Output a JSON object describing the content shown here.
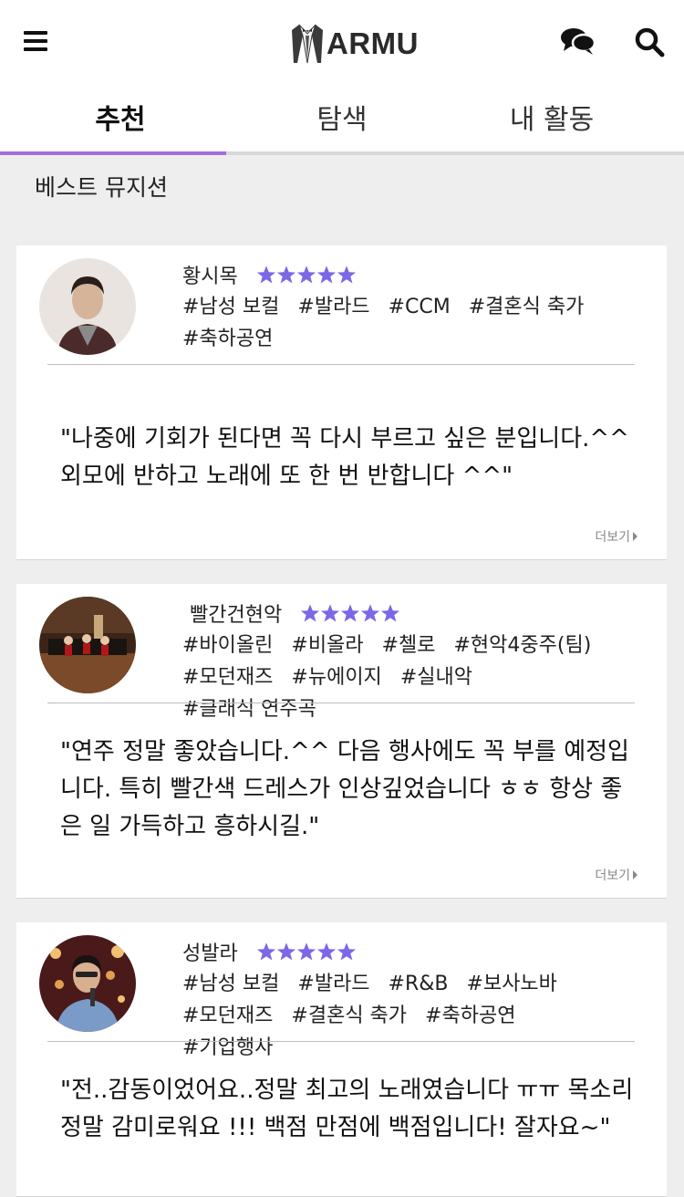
{
  "header": {
    "logo_text": "ARMU",
    "tabs": [
      {
        "label": "추천",
        "active": true
      },
      {
        "label": "탐색",
        "active": false
      },
      {
        "label": "내 활동",
        "active": false
      }
    ],
    "accent_color": "#a56ae0"
  },
  "section_title": "베스트 뮤지션",
  "star_color": "#7b68e6",
  "cards": [
    {
      "name": "황시목",
      "rating": 5,
      "tags_line1": [
        "#남성 보컬",
        "#발라드",
        "#CCM",
        "#결혼식 축가"
      ],
      "tags_line2": [
        "#축하공연"
      ],
      "review": "\"나중에 기회가 된다면 꼭 다시 부르고 싶은 분입니다.^^ 외모에 반하고 노래에 또 한 번 반합니다 ^^\"",
      "more_label": "더보기"
    },
    {
      "name": "빨간건현악",
      "rating": 5,
      "tags_line1": [
        "#바이올린",
        "#비올라",
        "#첼로",
        "#현악4중주(팀)"
      ],
      "tags_line2": [
        "#모던재즈",
        "#뉴에이지",
        "#실내악",
        "#클래식 연주곡"
      ],
      "review": "\"연주 정말 좋았습니다.^^ 다음 행사에도 꼭 부를 예정입니다. 특히 빨간색 드레스가 인상깊었습니다 ㅎㅎ 항상 좋은 일 가득하고 흥하시길.\"",
      "more_label": "더보기"
    },
    {
      "name": "성발라",
      "rating": 5,
      "tags_line1": [
        "#남성 보컬",
        "#발라드",
        "#R&B",
        "#보사노바"
      ],
      "tags_line2": [
        "#모던재즈",
        "#결혼식 축가",
        "#축하공연",
        "#기업행사"
      ],
      "review": "\"전..감동이었어요..정말 최고의 노래였습니다 ㅠㅠ 목소리 정말 감미로워요 !!! 백점 만점에 백점입니다! 잘자요~\"",
      "more_label": "더보기"
    }
  ]
}
